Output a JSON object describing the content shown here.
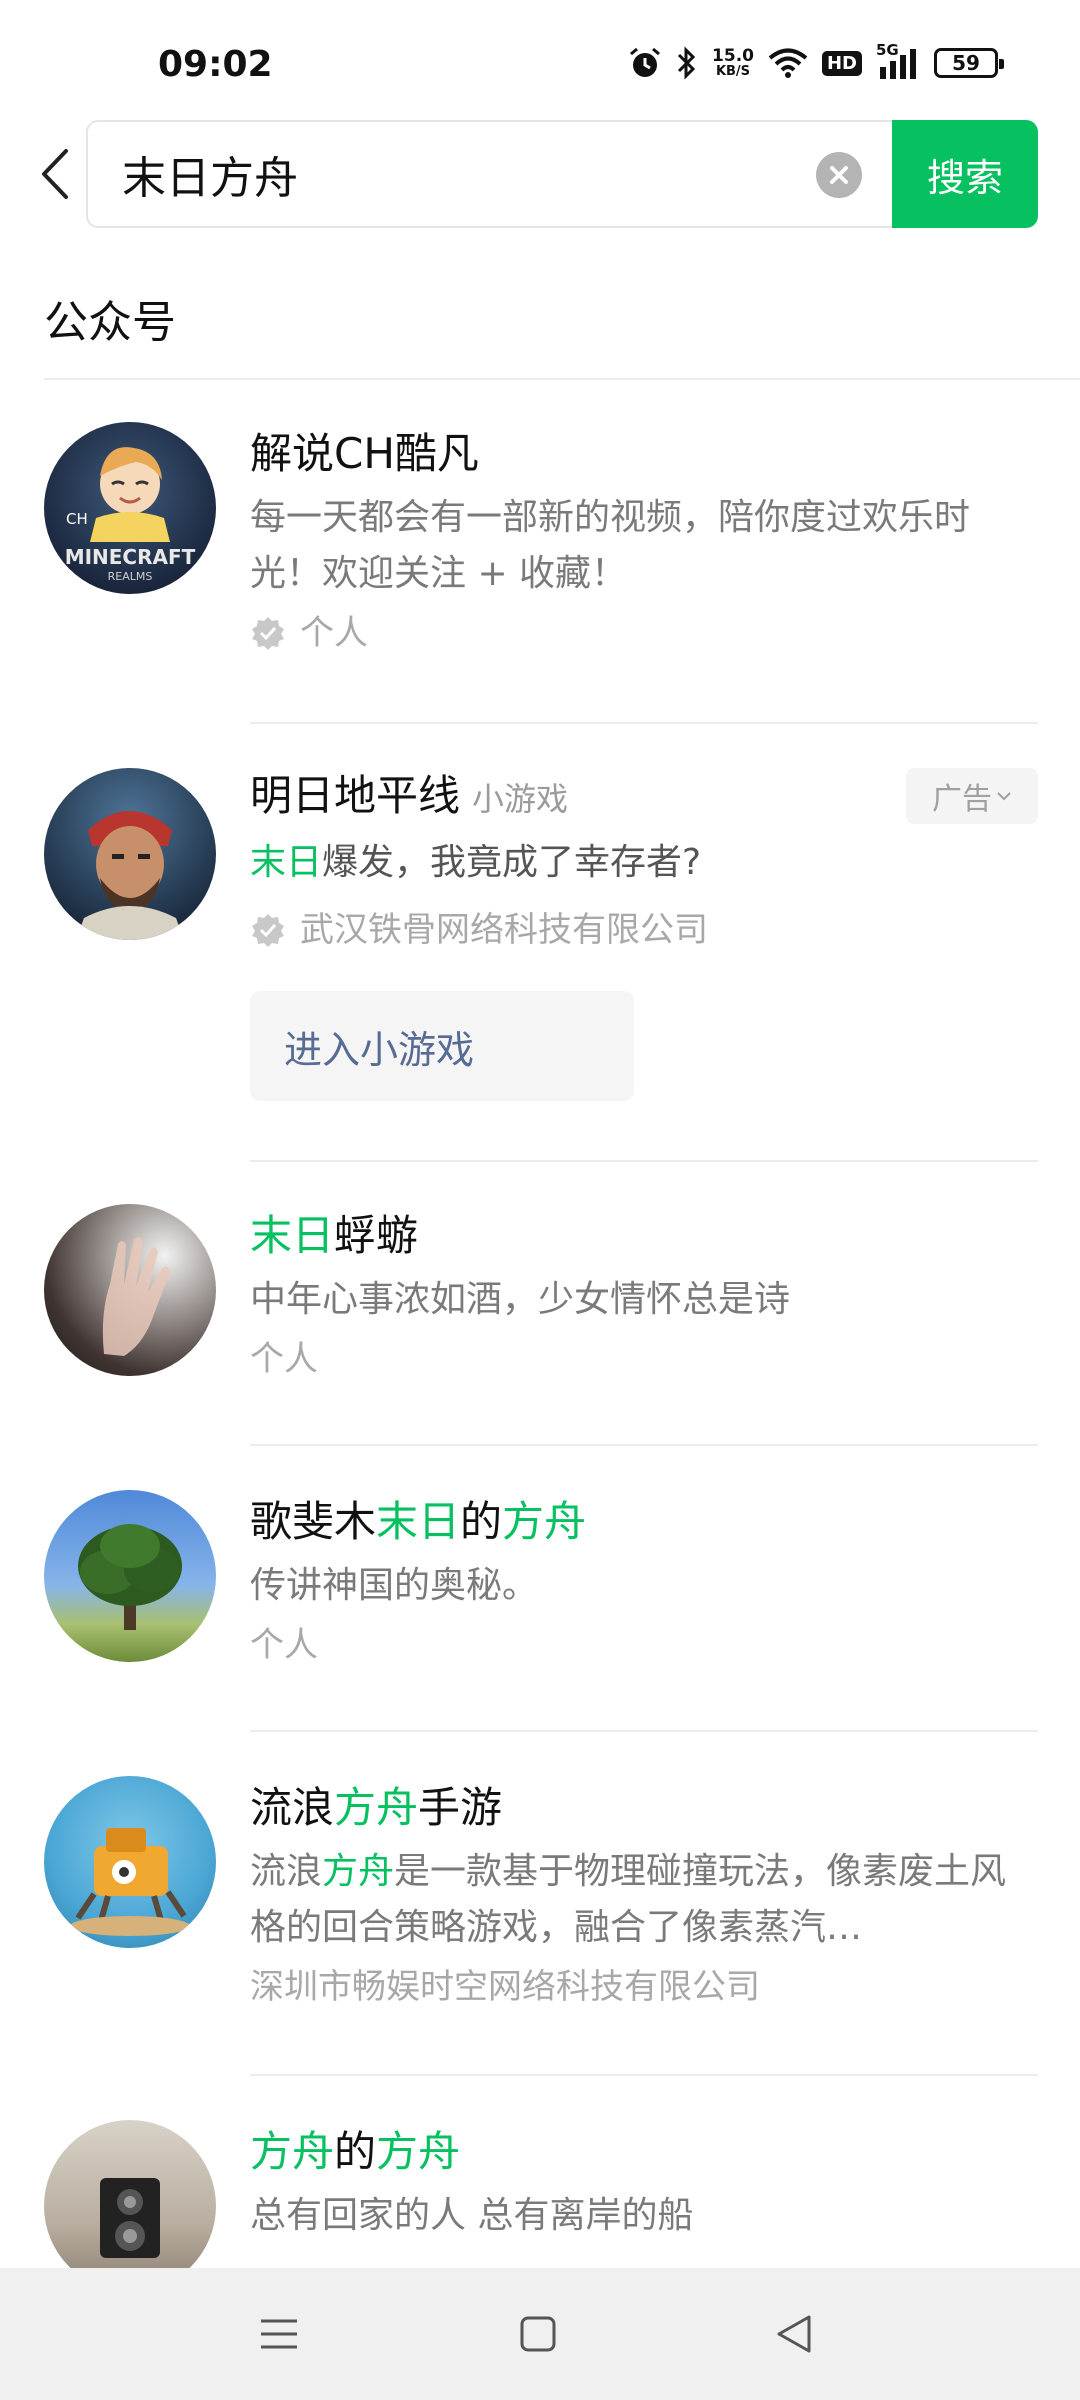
{
  "status_bar": {
    "time": "09:02",
    "net_speed_value": "15.0",
    "net_speed_unit": "KB/S",
    "hd": "HD",
    "signal_label": "5G",
    "battery": "59"
  },
  "search": {
    "query": "末日方舟",
    "button_label": "搜索"
  },
  "section": {
    "title": "公众号"
  },
  "results": [
    {
      "title": "解说CH酷凡",
      "desc": "每一天都会有一部新的视频，陪你度过欢乐时光！欢迎关注 + 收藏！",
      "meta": "个人"
    },
    {
      "title": "明日地平线",
      "title_tag": "小游戏",
      "ad_label": "广告",
      "desc_hl": "末日",
      "desc_rest": "爆发，我竟成了幸存者?",
      "meta": "武汉铁骨网络科技有限公司",
      "action_label": "进入小游戏"
    },
    {
      "title_hl": "末日",
      "title_rest": "蜉蝣",
      "desc": "中年心事浓如酒，少女情怀总是诗",
      "meta": "个人"
    },
    {
      "title_a": "歌斐木",
      "title_hl1": "末日",
      "title_b": "的",
      "title_hl2": "方舟",
      "desc": "传讲神国的奥秘。",
      "meta": "个人"
    },
    {
      "title_a": "流浪",
      "title_hl": "方舟",
      "title_b": "手游",
      "desc_a": "流浪",
      "desc_hl": "方舟",
      "desc_b": "是一款基于物理碰撞玩法，像素废土风格的回合策略游戏，融合了像素蒸汽…",
      "meta": "深圳市畅娱时空网络科技有限公司"
    },
    {
      "title_hl1": "方舟",
      "title_a": "的",
      "title_hl2": "方舟",
      "desc": "总有回家的人 总有离岸的船"
    }
  ],
  "avatar_text": {
    "ch": "CH",
    "minecraft": "MINECRAFT",
    "realms": "REALMS"
  },
  "icons": {
    "back": "chevron-left-icon",
    "clear": "clear-icon",
    "verify": "verified-badge-icon",
    "ad_chevron": "chevron-down-icon",
    "nav_menu": "menu-icon",
    "nav_home": "home-square-icon",
    "nav_back": "back-triangle-icon"
  },
  "colors": {
    "accent": "#07c160",
    "link": "#576b95",
    "secondary_text": "#7a7a7a"
  }
}
